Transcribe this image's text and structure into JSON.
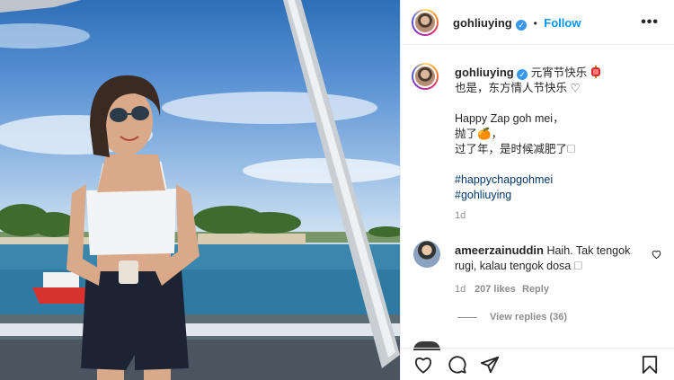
{
  "post": {
    "username": "gohliuying",
    "verified_mark": "✓",
    "follow_separator": "•",
    "follow_label": "Follow",
    "more_label": "•••"
  },
  "caption": {
    "username": "gohliuying",
    "line1_text": "元宵节快乐",
    "line2": "也是，东方情人节快乐 ♡",
    "line3": "Happy Zap goh mei，",
    "line4": "抛了🍊，",
    "line5": "过了年，是时候减肥了🗆",
    "hashtags": [
      "#happychapgohmei",
      "#gohliuying"
    ],
    "time": "1d"
  },
  "comment": {
    "username": "ameerzainuddin",
    "text_line1": "Haih. Tak tengok",
    "text_line2": "rugi, kalau tengok dosa 🗆",
    "time": "1d",
    "likes": "207 likes",
    "reply_label": "Reply",
    "view_replies": "View replies (36)"
  },
  "icons": [
    "heart-icon",
    "comment-icon",
    "share-icon",
    "bookmark-icon",
    "verified-icon",
    "more-icon",
    "red-lantern-icon"
  ],
  "colors": {
    "link_blue": "#0095f6",
    "hashtag_blue": "#00376b",
    "muted_gray": "#8e8e8e",
    "verified_blue": "#3897f0"
  }
}
